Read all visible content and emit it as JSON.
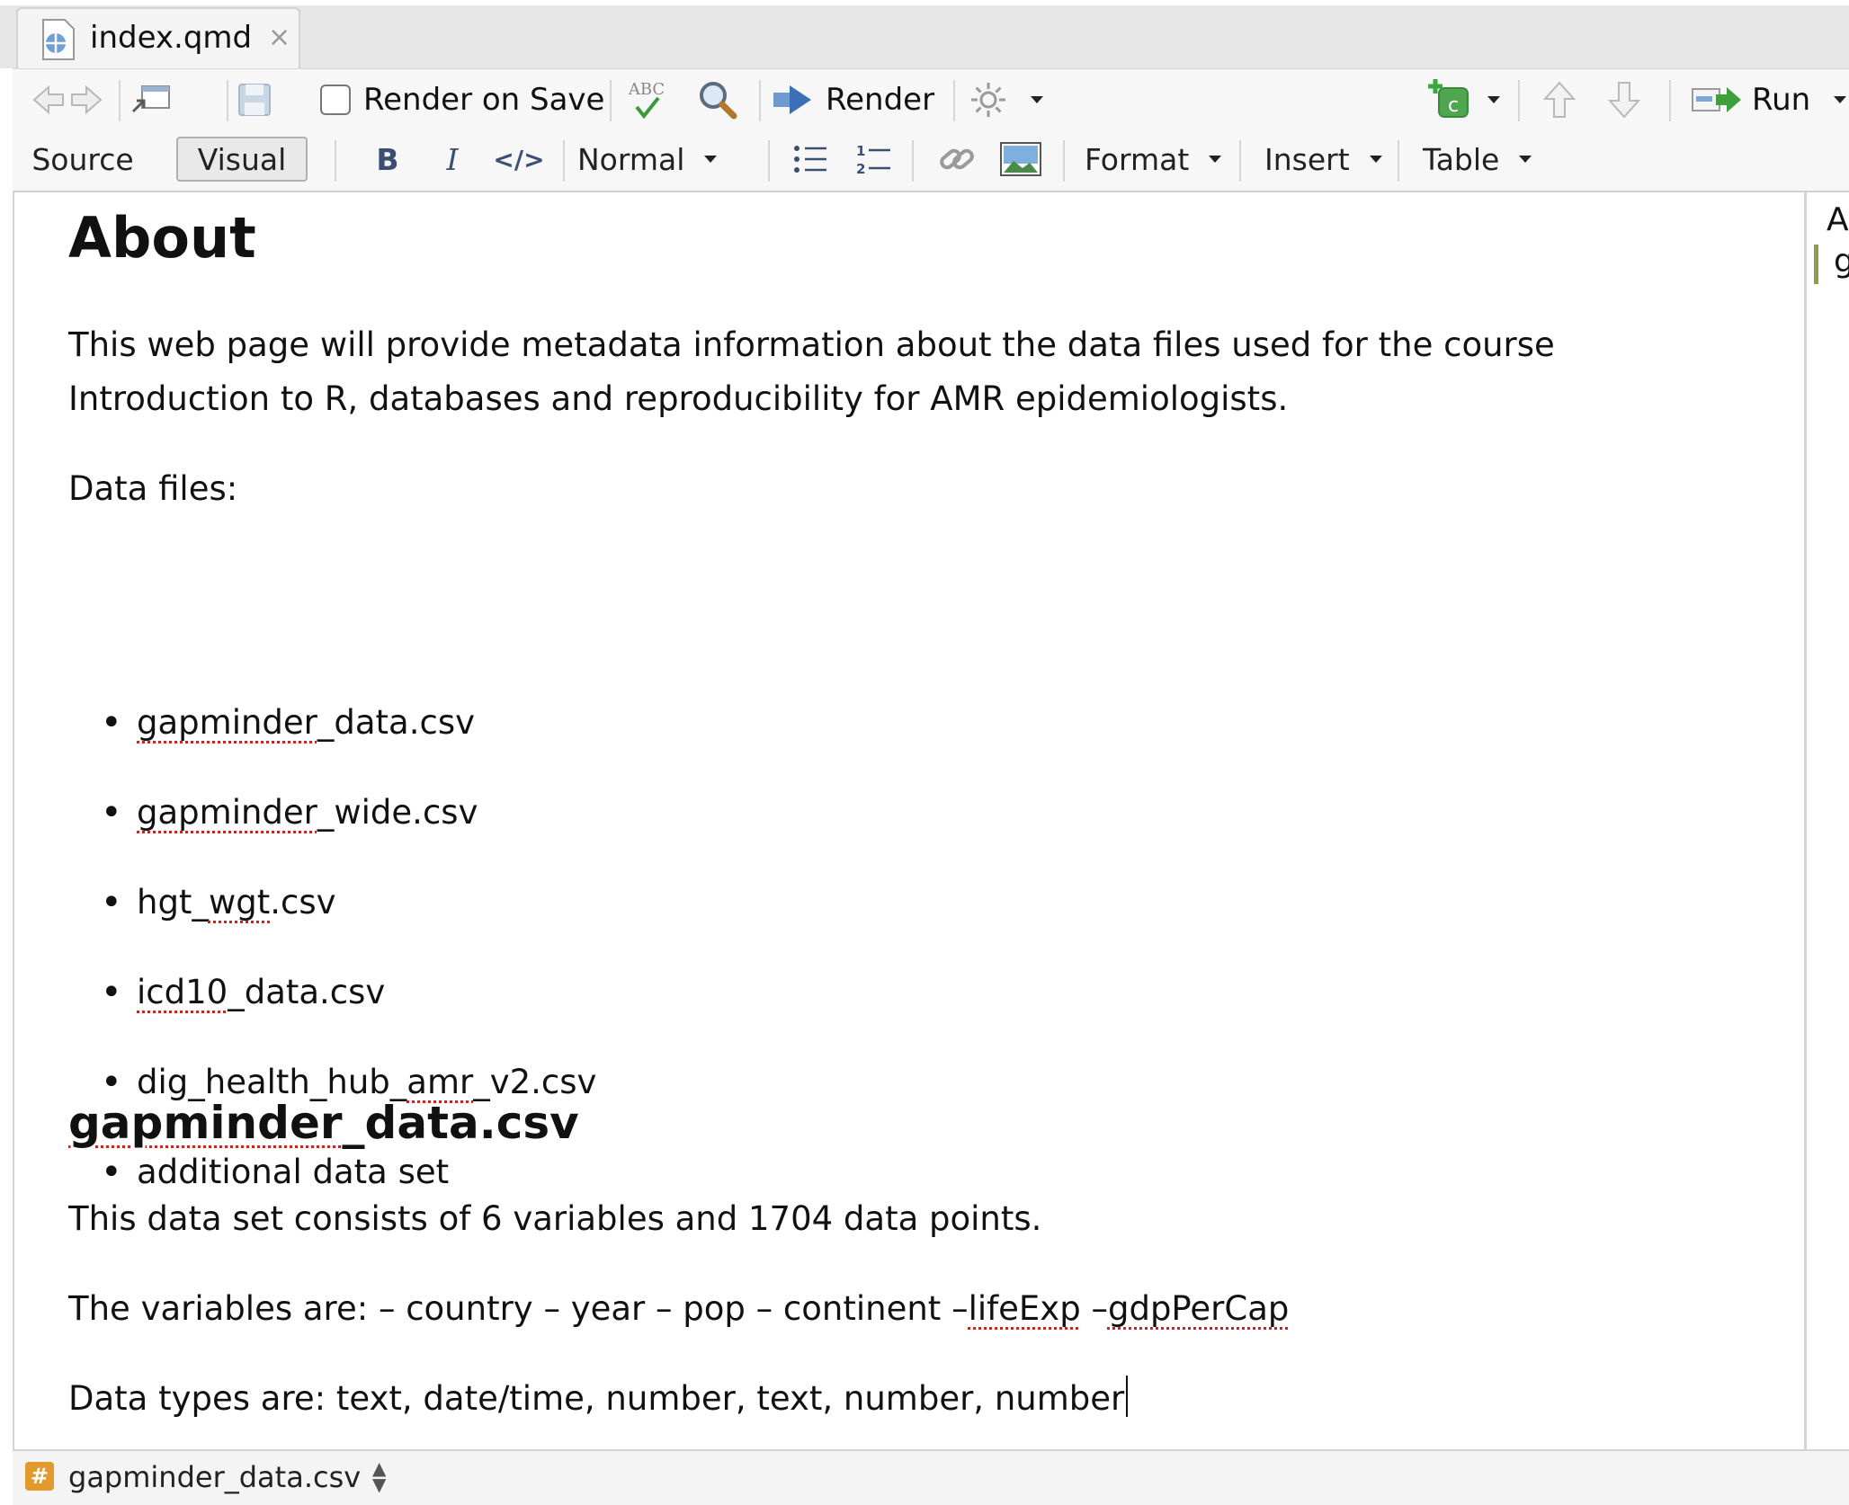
{
  "tab": {
    "label": "index.qmd",
    "close": "×"
  },
  "toolbar1": {
    "render_on_save": "Render on Save",
    "spell_label": "ABC",
    "render": "Render",
    "run": "Run"
  },
  "toolbar2": {
    "source": "Source",
    "visual": "Visual",
    "bold": "B",
    "italic": "I",
    "code": "</>",
    "style": "Normal",
    "format": "Format",
    "insert": "Insert",
    "table": "Table"
  },
  "document": {
    "h1": "About",
    "intro_line1": "This web page will provide metadata information about the data files used for the course",
    "intro_line2": "Introduction to R, databases and reproducibility for AMR epidemiologists.",
    "files_label": "Data files:",
    "files": [
      {
        "prefix": "",
        "spell": "gapminder",
        "suffix": "_data.csv"
      },
      {
        "prefix": "",
        "spell": "gapminder",
        "suffix": "_wide.csv"
      },
      {
        "prefix": "hgt_",
        "spell": "wgt",
        "suffix": ".csv"
      },
      {
        "prefix": "",
        "spell": "icd10",
        "suffix": "_data.csv"
      },
      {
        "prefix": "dig_health_hub_",
        "spell": "amr",
        "suffix": "_v2.csv"
      },
      {
        "prefix": "additional data set",
        "spell": "",
        "suffix": ""
      }
    ],
    "h2_spell": "gapminder",
    "h2_suffix": "_data.csv",
    "p1": "This data set consists of 6 variables and 1704 data points.",
    "vars_prefix": "The variables are: – country – year – pop – continent –",
    "vars_spell1": "lifeExp",
    "vars_mid": " –",
    "vars_spell2": "gdpPerCap",
    "types": "Data types are: text, date/time, number, text, number, number"
  },
  "outline": {
    "item1": "A",
    "item2": "g"
  },
  "statusbar": {
    "label": "gapminder_data.csv",
    "icon": "#"
  }
}
